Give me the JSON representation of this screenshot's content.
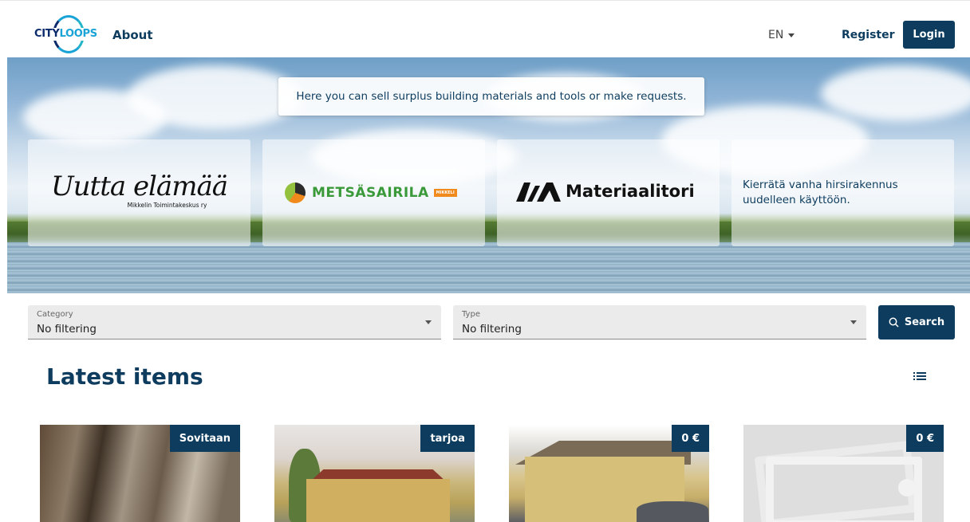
{
  "header": {
    "logo_city": "CITY",
    "logo_loops": "LOOPS",
    "nav_about": "About",
    "language": "EN",
    "register": "Register",
    "login": "Login"
  },
  "hero": {
    "banner": "Here you can sell surplus building materials and tools or make requests.",
    "partners": [
      {
        "name": "Uutta elämää",
        "sub": "Mikkelin Toimintakeskus ry"
      },
      {
        "name": "METSÄSAIRILA",
        "tag": "MIKKELI"
      },
      {
        "name": "Materiaalitori"
      },
      {
        "name": "Kierrätä vanha hirsirakennus uudelleen käyttöön."
      }
    ]
  },
  "filters": {
    "category_label": "Category",
    "category_value": "No filtering",
    "type_label": "Type",
    "type_value": "No filtering",
    "search_label": "Search"
  },
  "latest": {
    "title": "Latest items",
    "items": [
      {
        "badge": "Sovitaan"
      },
      {
        "badge": "tarjoa"
      },
      {
        "badge": "0 €"
      },
      {
        "badge": "0 €"
      }
    ]
  },
  "colors": {
    "primary": "#0d3c5e",
    "brand_light": "#1aa3d6",
    "metsa_green": "#3a9a3a",
    "metsa_orange": "#f08a1c"
  },
  "icons": [
    "cityloops-logo",
    "chevron-down-icon",
    "search-icon",
    "list-view-icon",
    "image-placeholder-icon"
  ]
}
